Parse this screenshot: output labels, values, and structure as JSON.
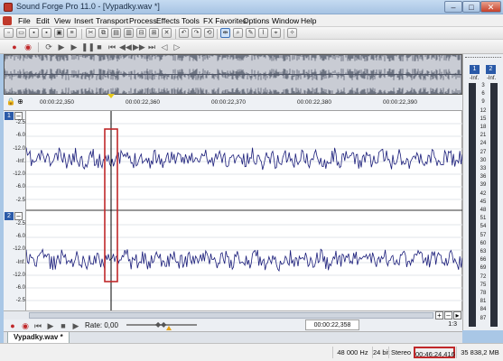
{
  "window": {
    "title": "Sound Forge Pro 11.0 - [Vypadky.wav *]",
    "minimize": "–",
    "maximize": "□",
    "close": "✕"
  },
  "menu": [
    "File",
    "Edit",
    "View",
    "Insert",
    "Transport",
    "Process",
    "Effects",
    "Tools",
    "FX Favorites",
    "Options",
    "Window",
    "Help"
  ],
  "timeline": {
    "ticks": [
      "00:00:22,350",
      "00:00:22,360",
      "00:00:22,370",
      "00:00:22,380",
      "00:00:22,390"
    ]
  },
  "db_scale": {
    "channel_top": [
      "-2.5",
      "-6.0",
      "-12.0",
      "-Inf.",
      "-12.0",
      "-6.0",
      "-2.5"
    ],
    "channel_bottom": [
      "-2.5",
      "-6.0",
      "-12.0",
      "-Inf.",
      "-12.0",
      "-6.0",
      "-2.5"
    ]
  },
  "channels": {
    "ch1": "1",
    "ch2": "2"
  },
  "meters": {
    "ch1_label": "1",
    "ch2_label": "2",
    "ch1_peak": "-Inf.",
    "ch2_peak": "-Inf.",
    "scale": [
      "3",
      "6",
      "9",
      "12",
      "15",
      "18",
      "21",
      "24",
      "27",
      "30",
      "33",
      "36",
      "39",
      "42",
      "45",
      "48",
      "51",
      "54",
      "57",
      "60",
      "63",
      "66",
      "69",
      "72",
      "75",
      "78",
      "81",
      "84",
      "87"
    ]
  },
  "transport": {
    "rate_label": "Rate: 0,00",
    "cursor_position": "00:00:22,358",
    "zoom_ratio": "1:3"
  },
  "tab": {
    "label": "Vypadky.wav *"
  },
  "status": {
    "sample_rate": "48 000 Hz",
    "bit_depth": "24 bit",
    "channels": "Stereo",
    "length": "00:46:24,416",
    "disk_space": "35 838,2 MB"
  }
}
